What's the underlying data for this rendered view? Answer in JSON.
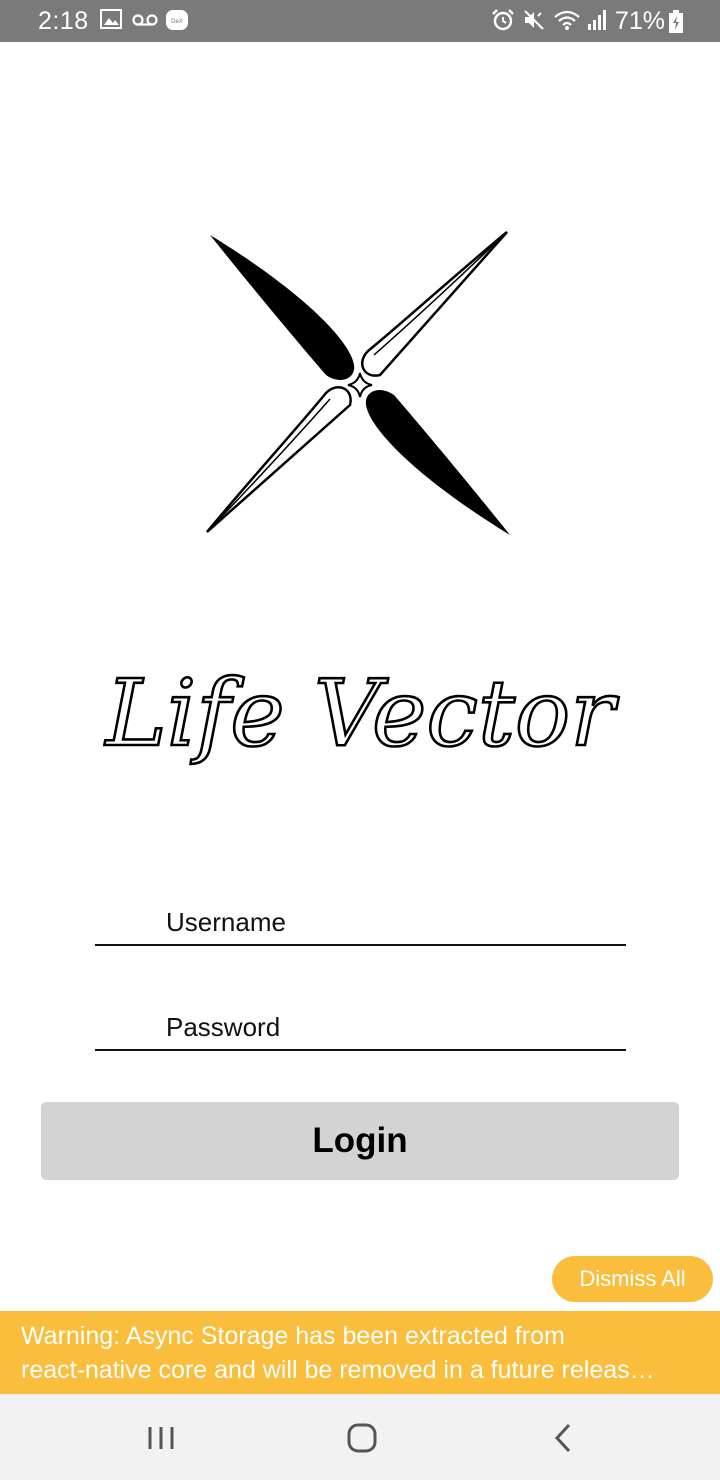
{
  "status_bar": {
    "time": "2:18",
    "battery_percent": "71%",
    "icons": [
      "image-icon",
      "voicemail-icon",
      "dex-icon",
      "alarm-icon",
      "mute-icon",
      "wifi-icon",
      "signal-icon",
      "battery-icon"
    ]
  },
  "app": {
    "brand_name": "Life Vector"
  },
  "login_form": {
    "username_placeholder": "Username",
    "password_placeholder": "Password",
    "login_label": "Login"
  },
  "yellow_box": {
    "dismiss_label": "Dismiss All",
    "warning_line1": "Warning: Async Storage has been extracted from",
    "warning_line2": "react-native core and will be removed in a future releas…",
    "color": "#fbbd3c"
  },
  "nav_bar": {
    "icons": [
      "recent-apps-icon",
      "home-icon",
      "back-icon"
    ]
  }
}
